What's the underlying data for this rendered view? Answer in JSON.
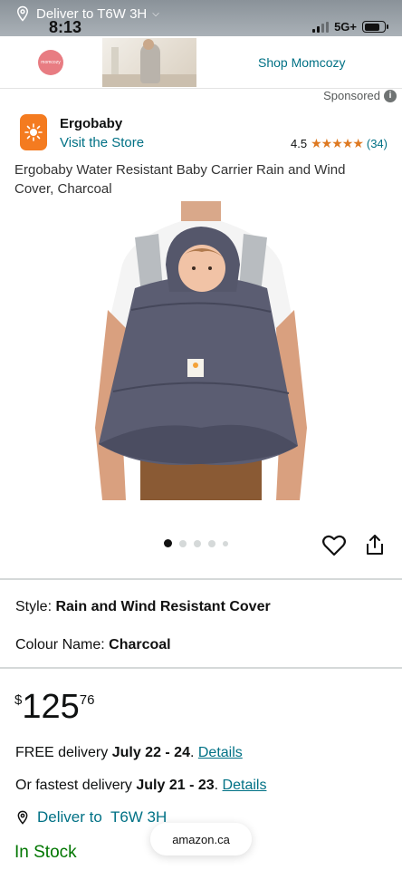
{
  "status_bar": {
    "time": "8:13",
    "network": "5G+",
    "deliver_to": "Deliver to T6W 3H"
  },
  "ad": {
    "logo_text": "momcozy",
    "cta": "Shop Momcozy"
  },
  "sponsored": {
    "label": "Sponsored",
    "info": "i"
  },
  "brand": {
    "name": "Ergobaby",
    "visit_store": "Visit the Store",
    "rating": "4.5",
    "stars": "★★★★★",
    "review_count": "(34)"
  },
  "product": {
    "title": "Ergobaby Water Resistant Baby Carrier Rain and Wind Cover, Charcoal",
    "image_alt": "Ergobaby rain cover worn over baby carrier",
    "gallery_count": 5,
    "gallery_active": 0
  },
  "options": {
    "style_label": "Style:",
    "style_value": "Rain and Wind Resistant Cover",
    "colour_label": "Colour Name:",
    "colour_value": "Charcoal"
  },
  "price": {
    "currency": "$",
    "whole": "125",
    "fraction": "76"
  },
  "delivery": {
    "free_prefix": "FREE delivery ",
    "free_dates": "July 22 - 24",
    "free_suffix": ". ",
    "free_link": "Details",
    "fast_prefix": "Or fastest delivery ",
    "fast_dates": "July 21 - 23",
    "fast_suffix": ". ",
    "fast_link": "Details"
  },
  "location": {
    "label": "Deliver to  T6W 3H"
  },
  "stock": {
    "label": "In Stock"
  },
  "browser": {
    "url": "amazon.ca"
  },
  "colors": {
    "link": "#007185",
    "stars": "#de7921",
    "stock": "#007600",
    "brand_orange": "#f47b20"
  }
}
